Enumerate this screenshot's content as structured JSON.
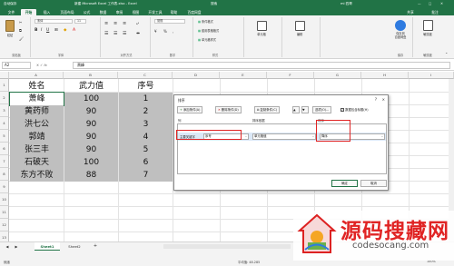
{
  "titlebar": {
    "autosave": "自动保存",
    "title": "新建 Microsoft Excel 工作表.xlsx - Excel",
    "search": "搜索",
    "user": "mi 四哥",
    "colors": {
      "green": "#217346"
    }
  },
  "ribbon_tabs": [
    "文件",
    "开始",
    "插入",
    "页面布局",
    "公式",
    "数据",
    "审阅",
    "视图",
    "开发工具",
    "帮助",
    "百度网盘"
  ],
  "ribbon_tabs_right": [
    "共享",
    "批注"
  ],
  "ribbon": {
    "paste": "粘贴",
    "clipboard": "剪贴板",
    "font_group": "字体",
    "font_name": "宋体",
    "font_size": "11",
    "align_group": "对齐方式",
    "number_group": "数字",
    "number_format": "常规",
    "cond_format": "条件格式",
    "table_format": "套用表格格式",
    "cell_style": "单元格样式",
    "style_group": "样式",
    "cells": "单元格",
    "edit": "编辑",
    "save_baidu": "保存到\n百度网盘",
    "sensitivity": "敏感度",
    "baidu_group": "保存",
    "sensitivity_group": "敏感度"
  },
  "formula_bar": {
    "cell_ref": "A2",
    "fx": "fx",
    "value": "萧峰"
  },
  "columns": [
    "A",
    "B",
    "C",
    "D",
    "E",
    "F",
    "G",
    "H",
    "I"
  ],
  "rows": [
    "1",
    "2",
    "3",
    "4",
    "5",
    "6",
    "7",
    "8",
    "9",
    "10",
    "11",
    "12",
    "13"
  ],
  "table": {
    "headers": [
      "姓名",
      "武力值",
      "序号"
    ],
    "rows": [
      [
        "萧峰",
        "100",
        "1"
      ],
      [
        "黄药师",
        "90",
        "2"
      ],
      [
        "洪七公",
        "90",
        "3"
      ],
      [
        "郭靖",
        "90",
        "4"
      ],
      [
        "张三丰",
        "90",
        "5"
      ],
      [
        "石破天",
        "100",
        "6"
      ],
      [
        "东方不败",
        "88",
        "7"
      ]
    ]
  },
  "sort_dialog": {
    "title": "排序",
    "help": "?",
    "close": "×",
    "add_level": "添加条件(A)",
    "delete_level": "删除条件(D)",
    "copy_level": "复制条件(C)",
    "options": "选项(O)...",
    "has_headers": "数据包含标题(H)",
    "col_header": "列",
    "sorton_header": "排序依据",
    "order_header": "次序",
    "sort_by": "主要关键字",
    "key": "序号",
    "sort_on": "单元格值",
    "order": "降序",
    "ok": "确定",
    "cancel": "取消"
  },
  "sheet_tabs": [
    "Sheet1",
    "Sheet2"
  ],
  "add_sheet": "+",
  "status": {
    "ready": "就绪",
    "stats": "平均值: 48.285",
    "zoom": "100%"
  },
  "watermark": {
    "cn": "源码搜藏网",
    "en": "codesocang.com"
  }
}
